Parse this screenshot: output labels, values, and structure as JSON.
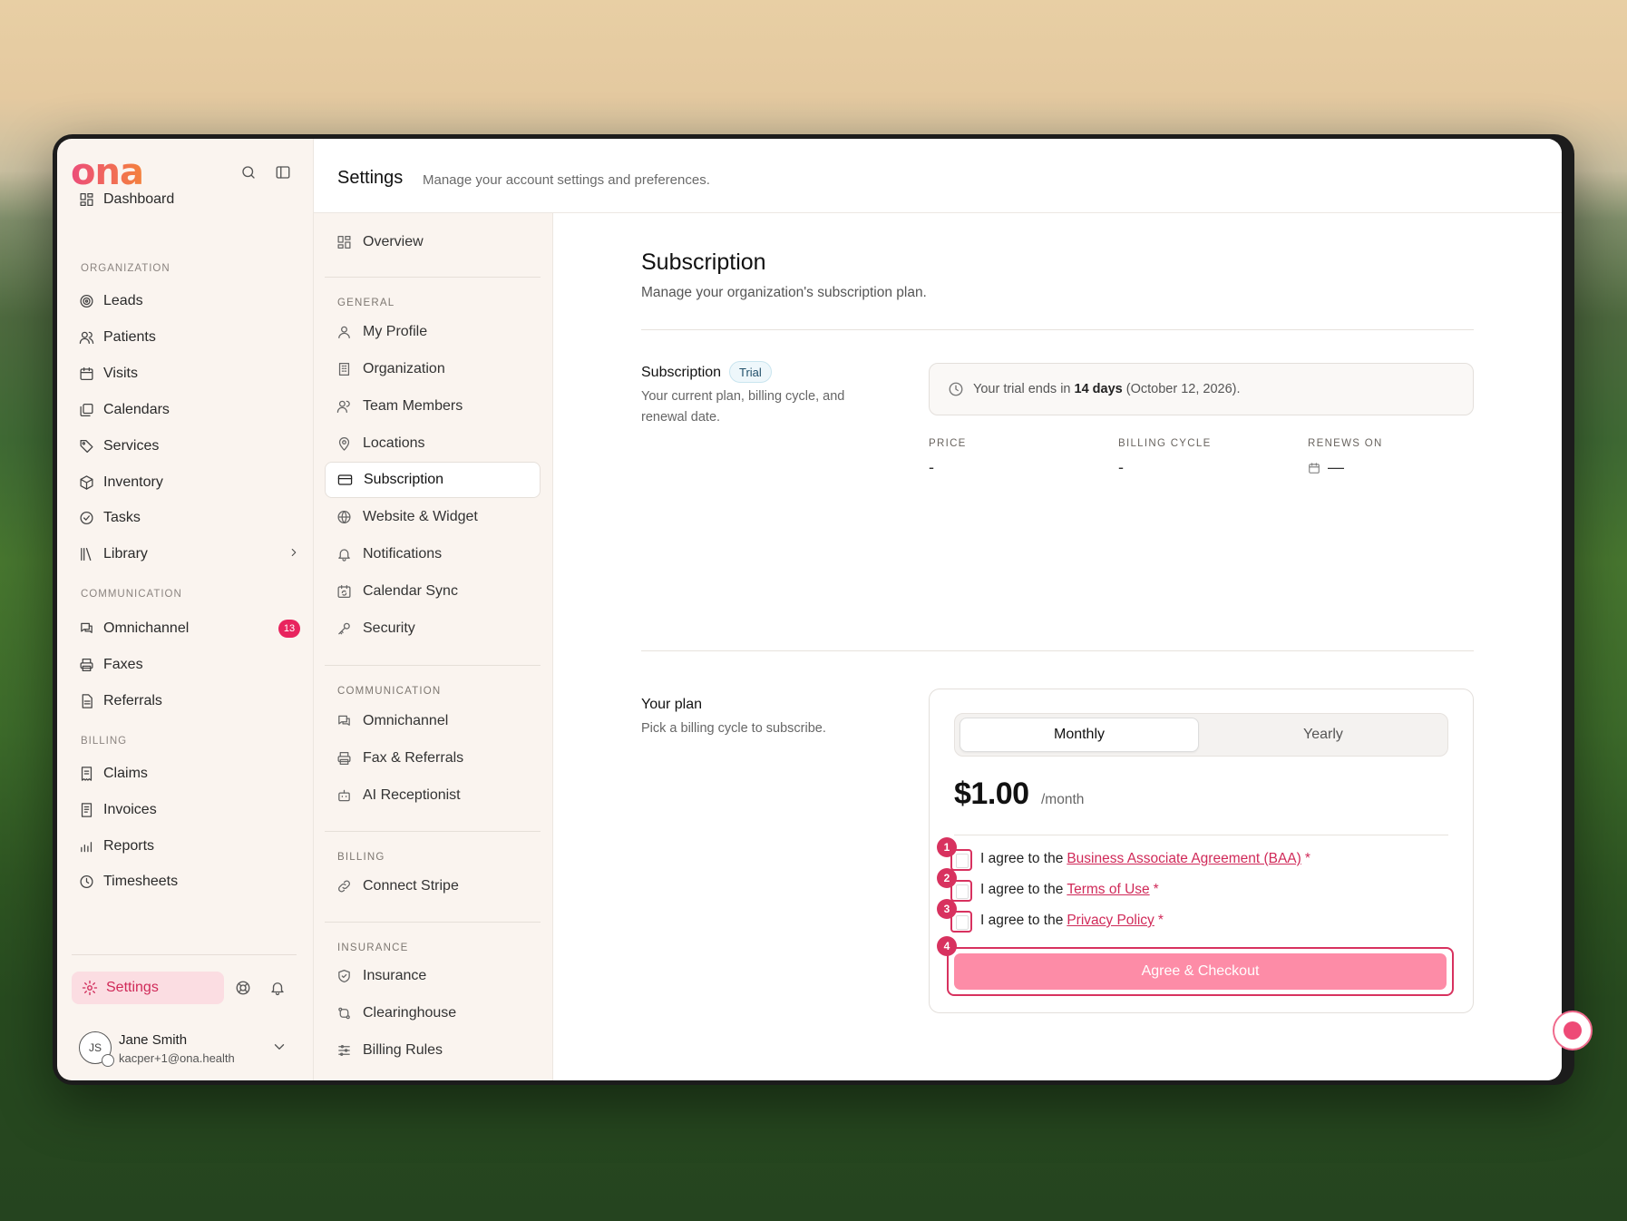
{
  "app": {
    "logo": "ona"
  },
  "sidebar": {
    "dashboard": "Dashboard",
    "sections": {
      "organization": "ORGANIZATION",
      "communication": "COMMUNICATION",
      "billing": "BILLING"
    },
    "organization": [
      {
        "label": "Leads",
        "icon": "target-icon"
      },
      {
        "label": "Patients",
        "icon": "users-icon"
      },
      {
        "label": "Visits",
        "icon": "calendar-icon"
      },
      {
        "label": "Calendars",
        "icon": "calendars-icon"
      },
      {
        "label": "Services",
        "icon": "tag-icon"
      },
      {
        "label": "Inventory",
        "icon": "box-icon"
      },
      {
        "label": "Tasks",
        "icon": "check-circle-icon"
      },
      {
        "label": "Library",
        "icon": "library-icon"
      }
    ],
    "communication": [
      {
        "label": "Omnichannel",
        "icon": "chat-icon",
        "badge": "13"
      },
      {
        "label": "Faxes",
        "icon": "printer-icon"
      },
      {
        "label": "Referrals",
        "icon": "document-icon"
      }
    ],
    "billing": [
      {
        "label": "Claims",
        "icon": "receipt-icon"
      },
      {
        "label": "Invoices",
        "icon": "invoice-icon"
      },
      {
        "label": "Reports",
        "icon": "chart-icon"
      },
      {
        "label": "Timesheets",
        "icon": "clock-icon"
      }
    ],
    "settings": "Settings",
    "user": {
      "initials": "JS",
      "name": "Jane Smith",
      "email": "kacper+1@ona.health"
    }
  },
  "header": {
    "title": "Settings",
    "subtitle": "Manage your account settings and preferences."
  },
  "subnav": {
    "overview": "Overview",
    "sections": {
      "general": "GENERAL",
      "communication": "COMMUNICATION",
      "billing": "BILLING",
      "insurance": "INSURANCE"
    },
    "general": [
      "My Profile",
      "Organization",
      "Team Members",
      "Locations",
      "Subscription",
      "Website & Widget",
      "Notifications",
      "Calendar Sync",
      "Security"
    ],
    "communication": [
      "Omnichannel",
      "Fax & Referrals",
      "AI Receptionist"
    ],
    "billing": [
      "Connect Stripe"
    ],
    "insurance": [
      "Insurance",
      "Clearinghouse",
      "Billing Rules"
    ],
    "active": "Subscription"
  },
  "content": {
    "title": "Subscription",
    "subtitle": "Manage your organization's subscription plan.",
    "subscription": {
      "label": "Subscription",
      "badge": "Trial",
      "desc": "Your current plan, billing cycle, and renewal date.",
      "trial_prefix": "Your trial ends in",
      "trial_days": "14 days",
      "trial_suffix": "(October 12, 2026).",
      "price_label": "PRICE",
      "price_value": "-",
      "cycle_label": "BILLING CYCLE",
      "cycle_value": "-",
      "renews_label": "RENEWS ON",
      "renews_value": "—"
    },
    "plan": {
      "label": "Your plan",
      "desc": "Pick a billing cycle to subscribe.",
      "monthly": "Monthly",
      "yearly": "Yearly",
      "price": "$1.00",
      "per": "/month",
      "agree_prefix": "I agree to the",
      "baa": "Business Associate Agreement (BAA)",
      "terms": "Terms of Use",
      "privacy": "Privacy Policy",
      "required": "*",
      "steps": [
        "1",
        "2",
        "3",
        "4"
      ],
      "checkout": "Agree & Checkout"
    }
  },
  "colors": {
    "accent": "#d02a59",
    "button": "#fd8ca7",
    "badge": "#e8245e"
  }
}
